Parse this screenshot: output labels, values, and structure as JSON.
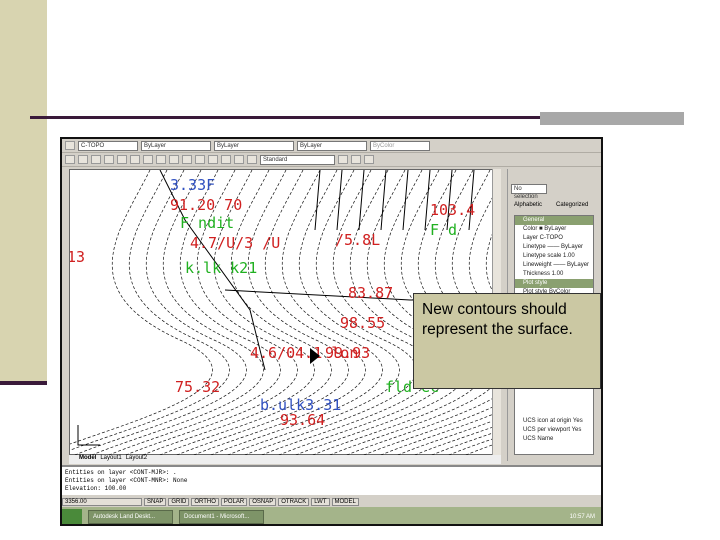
{
  "slide": {
    "callout": [
      "New contours should",
      "represent the surface."
    ]
  },
  "toolbar1": {
    "layer": "C-TOPO",
    "color": "ByLayer",
    "linetype": "ByLayer",
    "lineweight": "ByLayer",
    "plotstyle": "ByColor"
  },
  "toolbar2": {
    "dimstyle": "Standard"
  },
  "tabs": [
    "Model",
    "Layout1",
    "Layout2"
  ],
  "properties": {
    "selection": "No selection",
    "tab_alphabetic": "Alphabetic",
    "tab_categorized": "Categorized",
    "rows": [
      {
        "label": "General",
        "group": true
      },
      {
        "label": "Color   ■ ByLayer"
      },
      {
        "label": "Layer   C-TOPO"
      },
      {
        "label": "Linetype  —— ByLayer"
      },
      {
        "label": "Linetype scale 1.00"
      },
      {
        "label": "Lineweight —— ByLayer"
      },
      {
        "label": "Thickness  1.00"
      },
      {
        "label": "Plot style",
        "group": true
      },
      {
        "label": "Plot style  ByColor"
      }
    ],
    "rows_bottom": [
      "UCS icon at origin Yes",
      "UCS per viewport Yes",
      "UCS Name"
    ]
  },
  "command": {
    "lines": [
      "Entities on layer <CONT-MJR>: .",
      "Entities on layer <CONT-MNR>:      None",
      "Elevation: 100.00"
    ]
  },
  "status": {
    "coords": "3356.00",
    "buttons": [
      "SNAP",
      "GRID",
      "ORTHO",
      "POLAR",
      "OSNAP",
      "OTRACK",
      "LWT",
      "MODEL"
    ]
  },
  "taskbar": {
    "tasks": [
      "Autodesk Land Deskt...",
      "Document1 - Microsoft..."
    ],
    "clock": "10:57 AM"
  },
  "drawing": {
    "labels": [
      {
        "t": "3.33F",
        "c": "#3050c0"
      },
      {
        "t": "91.20 70",
        "c": "#d02020"
      },
      {
        "t": "F ndit",
        "c": "#20b020"
      },
      {
        "t": "13",
        "c": "#d02020"
      },
      {
        "t": "4.7/U/3 /U",
        "c": "#d02020"
      },
      {
        "t": "k.lk k21",
        "c": "#20b020"
      },
      {
        "t": "83.87",
        "c": "#d02020"
      },
      {
        "t": "98.55",
        "c": "#d02020"
      },
      {
        "t": "99.93",
        "c": "#d02020"
      },
      {
        "t": "4.6/04.1 lon",
        "c": "#d02020"
      },
      {
        "t": "75.32",
        "c": "#d02020"
      },
      {
        "t": "93.64",
        "c": "#d02020"
      },
      {
        "t": "fld ec",
        "c": "#20b020"
      },
      {
        "t": "103.4",
        "c": "#d02020"
      },
      {
        "t": "F d",
        "c": "#20b020"
      },
      {
        "t": "/5.8L",
        "c": "#d02020"
      },
      {
        "t": "b.ulk3.31",
        "c": "#3050c0"
      }
    ]
  },
  "colors": {
    "accent": "#cbc8a3",
    "leftbar": "#d8d4b0"
  }
}
